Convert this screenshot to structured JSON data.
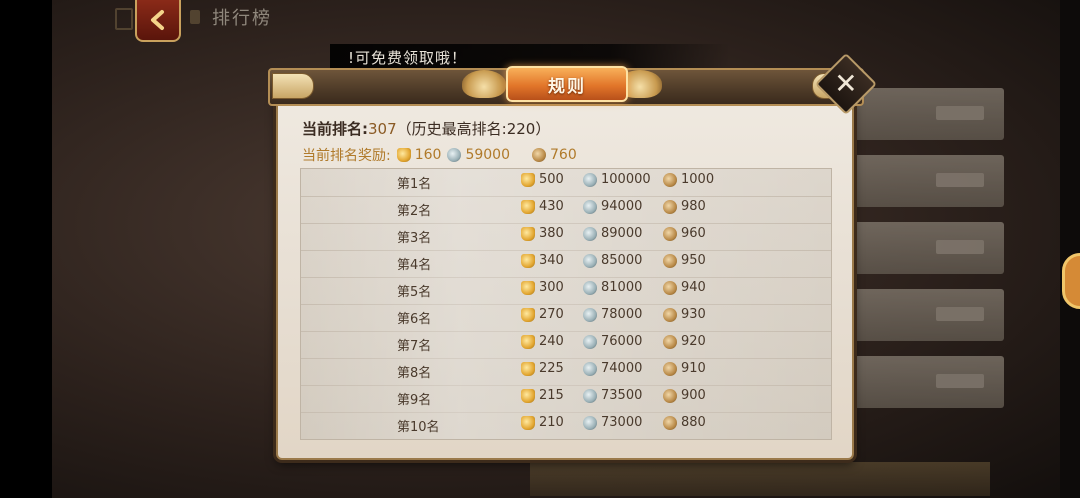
{
  "nav": {
    "back_icon": "chevron-left-icon",
    "title": "排行榜"
  },
  "banner": {
    "text": "!可免费领取哦！"
  },
  "modal": {
    "title": "规则",
    "close_icon": "close-icon",
    "current_rank_label": "当前排名:",
    "current_rank_value": "307",
    "history_text": "（历史最高排名:220）",
    "reward_label": "当前排名奖励:",
    "current_reward": {
      "gold": "160",
      "silver": "59000",
      "copper": "760"
    },
    "ranks": [
      {
        "rank": "第1名",
        "gold": "500",
        "silver": "100000",
        "copper": "1000"
      },
      {
        "rank": "第2名",
        "gold": "430",
        "silver": "94000",
        "copper": "980"
      },
      {
        "rank": "第3名",
        "gold": "380",
        "silver": "89000",
        "copper": "960"
      },
      {
        "rank": "第4名",
        "gold": "340",
        "silver": "85000",
        "copper": "950"
      },
      {
        "rank": "第5名",
        "gold": "300",
        "silver": "81000",
        "copper": "940"
      },
      {
        "rank": "第6名",
        "gold": "270",
        "silver": "78000",
        "copper": "930"
      },
      {
        "rank": "第7名",
        "gold": "240",
        "silver": "76000",
        "copper": "920"
      },
      {
        "rank": "第8名",
        "gold": "225",
        "silver": "74000",
        "copper": "910"
      },
      {
        "rank": "第9名",
        "gold": "215",
        "silver": "73500",
        "copper": "900"
      },
      {
        "rank": "第10名",
        "gold": "210",
        "silver": "73000",
        "copper": "880"
      }
    ]
  },
  "icons": {
    "gold": "gold-ingot-icon",
    "silver": "silver-coin-icon",
    "copper": "copper-coin-icon"
  },
  "colors": {
    "title_plate": "#e2762a",
    "accent_text": "#b07a2a"
  }
}
